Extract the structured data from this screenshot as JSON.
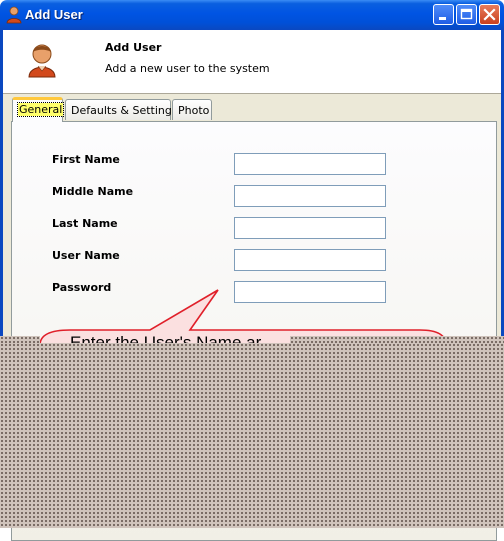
{
  "window": {
    "title": "Add User",
    "icon": "user-icon",
    "controls": {
      "minimize": "minimize-icon",
      "maximize": "maximize-icon",
      "close": "close-icon"
    }
  },
  "header": {
    "title": "Add User",
    "subtitle": "Add a new user to the system",
    "icon": "user-icon"
  },
  "tabs": [
    {
      "label": "General",
      "active": true
    },
    {
      "label": "Defaults & Settings",
      "active": false
    },
    {
      "label": "Photo",
      "active": false
    }
  ],
  "form": {
    "fields": [
      {
        "label": "First Name",
        "value": ""
      },
      {
        "label": "Middle Name",
        "value": ""
      },
      {
        "label": "Last Name",
        "value": ""
      },
      {
        "label": "User Name",
        "value": ""
      },
      {
        "label": "Password",
        "value": ""
      }
    ]
  },
  "callout": {
    "text": "Enter the User's Name ar"
  },
  "colors": {
    "titlebar": "#0054e3",
    "callout_border": "#e0202a",
    "callout_fill": "#fbe0e0",
    "active_tab_highlight": "#ffff6a"
  }
}
